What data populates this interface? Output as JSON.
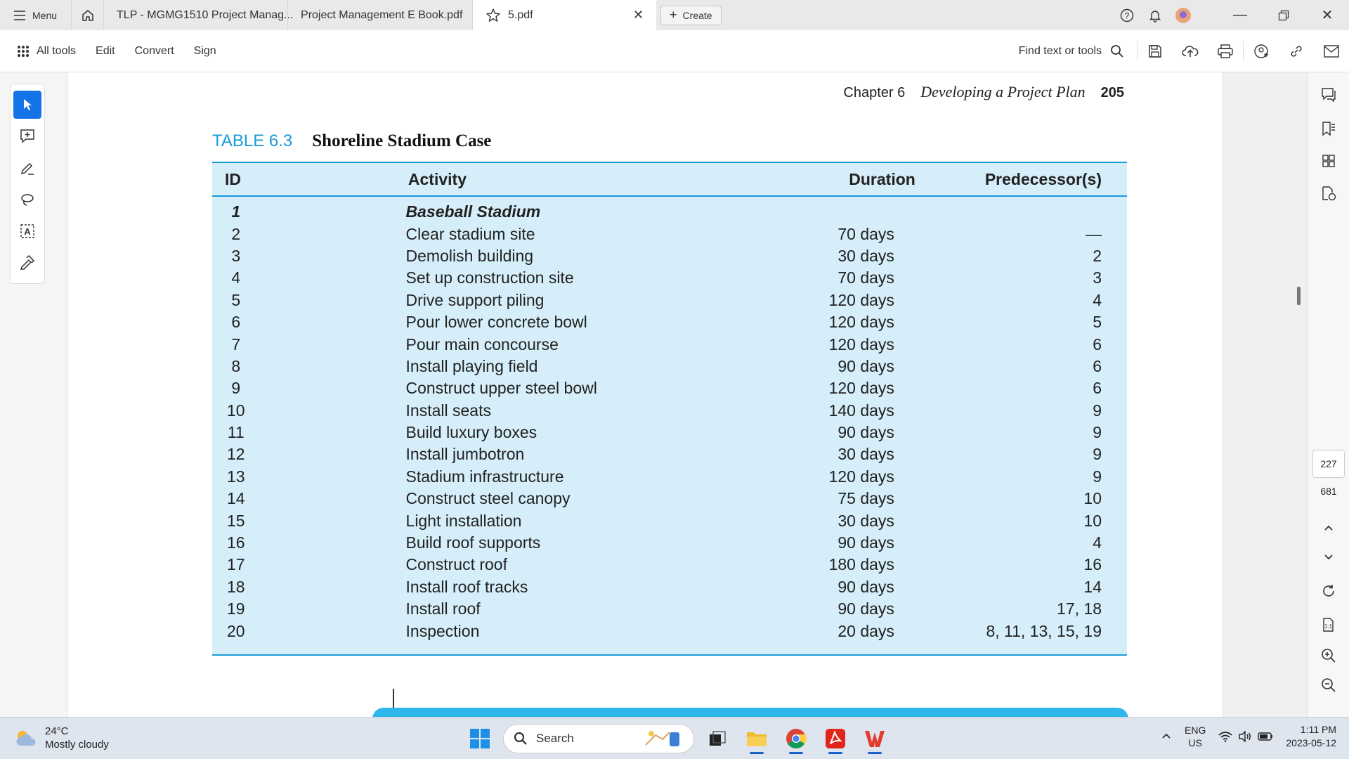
{
  "tabbar": {
    "menu_label": "Menu",
    "tabs": [
      {
        "label": "TLP - MGMG1510 Project Manag..."
      },
      {
        "label": "Project Management E Book.pdf"
      },
      {
        "label": "5.pdf"
      }
    ],
    "create_label": "Create"
  },
  "toolbar": {
    "all_tools": "All tools",
    "edit": "Edit",
    "convert": "Convert",
    "sign": "Sign",
    "find_placeholder": "Find text or tools"
  },
  "document": {
    "running_head": {
      "chapter": "Chapter 6",
      "title": "Developing a Project Plan",
      "page": "205"
    },
    "table_label": "TABLE 6.3",
    "table_title": "Shoreline Stadium Case",
    "columns": [
      "ID",
      "Activity",
      "Duration",
      "Predecessor(s)"
    ],
    "rows": [
      {
        "id": "1",
        "activity": "Baseball Stadium",
        "duration": "",
        "pred": "",
        "section": true
      },
      {
        "id": "2",
        "activity": "Clear stadium site",
        "duration": "70 days",
        "pred": "—"
      },
      {
        "id": "3",
        "activity": "Demolish building",
        "duration": "30 days",
        "pred": "2"
      },
      {
        "id": "4",
        "activity": "Set up construction site",
        "duration": "70 days",
        "pred": "3"
      },
      {
        "id": "5",
        "activity": "Drive support piling",
        "duration": "120 days",
        "pred": "4"
      },
      {
        "id": "6",
        "activity": "Pour lower concrete bowl",
        "duration": "120 days",
        "pred": "5"
      },
      {
        "id": "7",
        "activity": "Pour main concourse",
        "duration": "120 days",
        "pred": "6"
      },
      {
        "id": "8",
        "activity": "Install playing field",
        "duration": "90 days",
        "pred": "6"
      },
      {
        "id": "9",
        "activity": "Construct upper steel bowl",
        "duration": "120 days",
        "pred": "6"
      },
      {
        "id": "10",
        "activity": "Install seats",
        "duration": "140 days",
        "pred": "9"
      },
      {
        "id": "11",
        "activity": "Build luxury boxes",
        "duration": "90 days",
        "pred": "9"
      },
      {
        "id": "12",
        "activity": "Install jumbotron",
        "duration": "30 days",
        "pred": "9"
      },
      {
        "id": "13",
        "activity": "Stadium infrastructure",
        "duration": "120 days",
        "pred": "9"
      },
      {
        "id": "14",
        "activity": "Construct steel canopy",
        "duration": "75 days",
        "pred": "10"
      },
      {
        "id": "15",
        "activity": "Light installation",
        "duration": "30 days",
        "pred": "10"
      },
      {
        "id": "16",
        "activity": "Build roof supports",
        "duration": "90 days",
        "pred": "4"
      },
      {
        "id": "17",
        "activity": "Construct roof",
        "duration": "180 days",
        "pred": "16"
      },
      {
        "id": "18",
        "activity": "Install roof tracks",
        "duration": "90 days",
        "pred": "14"
      },
      {
        "id": "19",
        "activity": "Install roof",
        "duration": "90 days",
        "pred": "17, 18"
      },
      {
        "id": "20",
        "activity": "Inspection",
        "duration": "20 days",
        "pred": "8, 11, 13, 15, 19"
      }
    ]
  },
  "navigation": {
    "current_page": "227",
    "total_pages": "681"
  },
  "taskbar": {
    "weather_temp": "24°C",
    "weather_desc": "Mostly cloudy",
    "search_label": "Search",
    "lang_top": "ENG",
    "lang_bottom": "US",
    "time": "1:11 PM",
    "date": "2023-05-12"
  },
  "colors": {
    "accent": "#1473e6",
    "table_blue": "#1a9bd7",
    "table_fill": "#d5eef9"
  }
}
